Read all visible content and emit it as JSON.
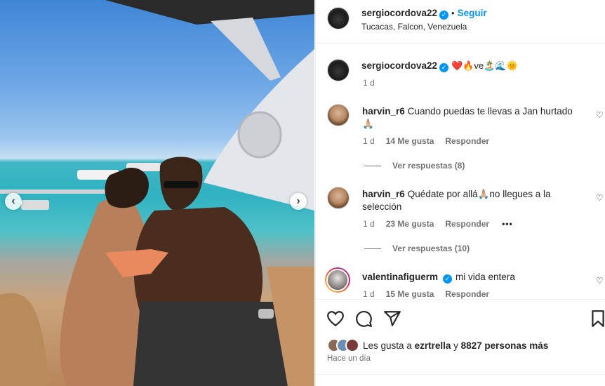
{
  "post": {
    "owner": "sergiocordova22",
    "follow_label": "Seguir",
    "dot": "•",
    "location": "Tucacas, Falcon, Venezuela",
    "caption_emojis": "❤️🔥ve🏝️🌊🌞",
    "caption_age": "1 d",
    "nav_prev": "‹",
    "nav_next": "›"
  },
  "comments": [
    {
      "user": "harvin_r6",
      "text": "Cuando puedas te llevas a Jan hurtado 🙏🏼",
      "age": "1 d",
      "likes": "14 Me gusta",
      "reply": "Responder",
      "view_replies": "Ver respuestas (8)"
    },
    {
      "user": "harvin_r6",
      "text": "Quédate por allá🙏🏼no llegues a la selección",
      "age": "1 d",
      "likes": "23 Me gusta",
      "reply": "Responder",
      "more": "•••",
      "view_replies": "Ver respuestas (10)"
    },
    {
      "user": "valentinafiguerm",
      "text": "mi vida entera",
      "age": "1 d",
      "likes": "15 Me gusta",
      "reply": "Responder"
    }
  ],
  "footer": {
    "liked_prefix": "Les gusta a",
    "liked_user": "ezrtrella",
    "liked_mid": "y",
    "liked_count": "8827 personas más",
    "time": "Hace un día"
  },
  "icons": [
    "heart-icon",
    "comment-icon",
    "share-icon",
    "bookmark-icon",
    "verified-icon",
    "chevron-left-icon",
    "chevron-right-icon"
  ],
  "colors": {
    "accent": "#0095f6",
    "text": "#262626",
    "muted": "#737373",
    "divider": "#efefef"
  }
}
